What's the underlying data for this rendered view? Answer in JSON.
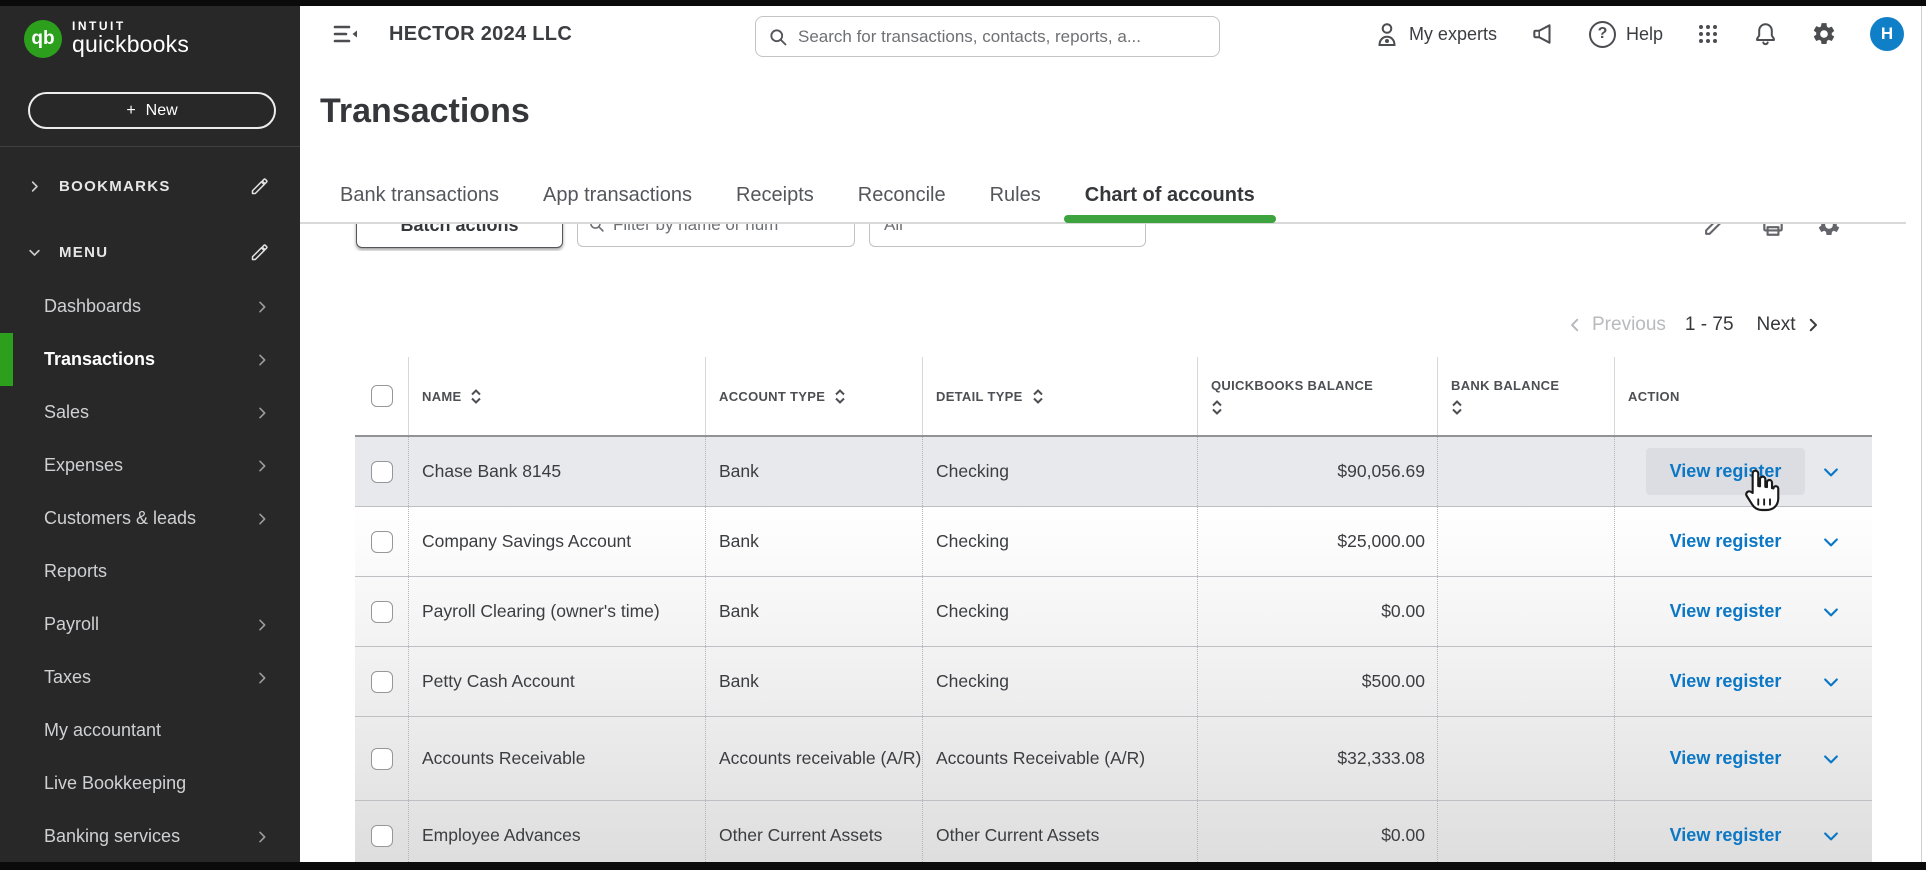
{
  "brand": {
    "monogram": "qb",
    "intuit": "intuit",
    "quickbooks": "quickbooks"
  },
  "sidebar": {
    "new_button": "New",
    "plus": "+",
    "bookmarks_label": "BOOKMARKS",
    "menu_label": "MENU",
    "items": [
      {
        "label": "Dashboards",
        "chevron": true
      },
      {
        "label": "Transactions",
        "chevron": true,
        "active": true
      },
      {
        "label": "Sales",
        "chevron": true
      },
      {
        "label": "Expenses",
        "chevron": true
      },
      {
        "label": "Customers & leads",
        "chevron": true
      },
      {
        "label": "Reports",
        "chevron": false
      },
      {
        "label": "Payroll",
        "chevron": true
      },
      {
        "label": "Taxes",
        "chevron": true
      },
      {
        "label": "My accountant",
        "chevron": false
      },
      {
        "label": "Live Bookkeeping",
        "chevron": false
      },
      {
        "label": "Banking services",
        "chevron": true
      }
    ]
  },
  "header": {
    "company": "HECTOR 2024 LLC",
    "search_placeholder": "Search for transactions, contacts, reports, a...",
    "my_experts": "My experts",
    "help": "Help",
    "help_glyph": "?",
    "avatar": "H"
  },
  "page": {
    "title": "Transactions"
  },
  "tabs": [
    {
      "label": "Bank transactions"
    },
    {
      "label": "App transactions"
    },
    {
      "label": "Receipts"
    },
    {
      "label": "Reconcile"
    },
    {
      "label": "Rules"
    },
    {
      "label": "Chart of accounts",
      "active": true
    }
  ],
  "controls": {
    "batch_actions": "Batch actions",
    "filter_placeholder": "Filter by name or num",
    "type_filter_value": "All"
  },
  "pagination": {
    "previous": "Previous",
    "range": "1 - 75",
    "next": "Next"
  },
  "table": {
    "columns": [
      "NAME",
      "ACCOUNT TYPE",
      "DETAIL TYPE",
      "QUICKBOOKS BALANCE",
      "BANK BALANCE",
      "ACTION"
    ],
    "rows": [
      {
        "name": "Chase Bank 8145",
        "account_type": "Bank",
        "detail_type": "Checking",
        "quickbooks_balance": "$90,056.69",
        "bank_balance": "",
        "action": "View register",
        "highlight": true
      },
      {
        "name": "Company Savings Account",
        "account_type": "Bank",
        "detail_type": "Checking",
        "quickbooks_balance": "$25,000.00",
        "bank_balance": "",
        "action": "View register"
      },
      {
        "name": "Payroll Clearing (owner's time)",
        "account_type": "Bank",
        "detail_type": "Checking",
        "quickbooks_balance": "$0.00",
        "bank_balance": "",
        "action": "View register"
      },
      {
        "name": "Petty Cash Account",
        "account_type": "Bank",
        "detail_type": "Checking",
        "quickbooks_balance": "$500.00",
        "bank_balance": "",
        "action": "View register"
      },
      {
        "name": "Accounts Receivable",
        "account_type": "Accounts receivable (A/R)",
        "detail_type": "Accounts Receivable (A/R)",
        "quickbooks_balance": "$32,333.08",
        "bank_balance": "",
        "action": "View register",
        "tall": true
      },
      {
        "name": "Employee Advances",
        "account_type": "Other Current Assets",
        "detail_type": "Other Current Assets",
        "quickbooks_balance": "$0.00",
        "bank_balance": "",
        "action": "View register"
      }
    ]
  },
  "colors": {
    "brand_green": "#2ca01c",
    "tab_underline_green": "#3da33f",
    "link_blue": "#0b77c5",
    "avatar_blue": "#0f80c8"
  }
}
